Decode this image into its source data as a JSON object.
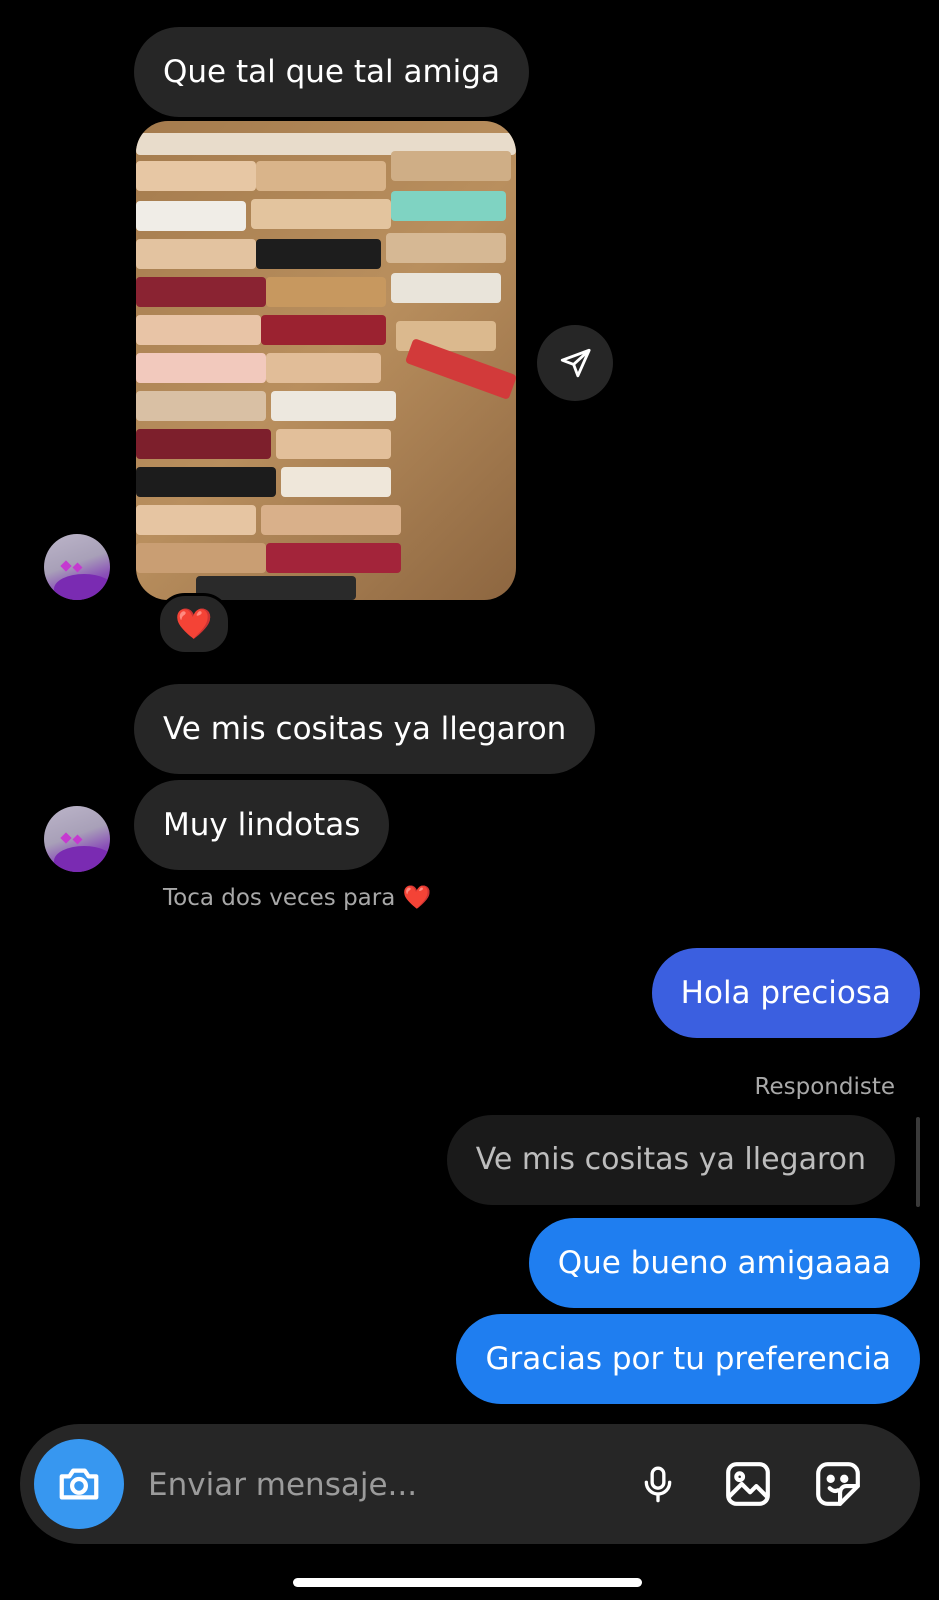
{
  "messages": {
    "m1": "Que tal que tal amiga",
    "m2": "Ve mis cositas ya llegaron",
    "m3": "Muy lindotas",
    "hint_text": "Toca dos veces para",
    "hint_icon": "heart-icon",
    "out1": "Hola preciosa",
    "replied_label": "Respondiste",
    "quoted_text": "Ve mis cositas ya llegaron",
    "out2": "Que bueno amigaaaa",
    "out3": "Gracias por tu preferencia"
  },
  "reaction": {
    "emoji": "❤️"
  },
  "composer": {
    "placeholder": "Enviar mensaje...",
    "icons": [
      "camera-icon",
      "microphone-icon",
      "gallery-icon",
      "sticker-icon"
    ]
  },
  "colors": {
    "background": "#000000",
    "incoming_bubble": "#262626",
    "outgoing_bubble_1": "#3b5fe0",
    "outgoing_bubble_2": "#1f7ef0",
    "camera_button": "#3797f0",
    "heart": "#ff3040"
  }
}
